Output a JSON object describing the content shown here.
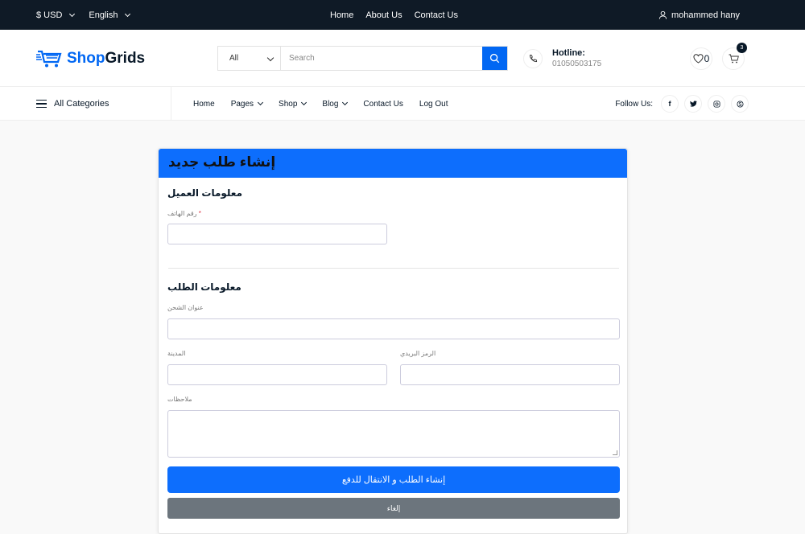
{
  "topbar": {
    "currency": "$ USD",
    "language": "English",
    "links": [
      "Home",
      "About Us",
      "Contact Us"
    ],
    "user": "mohammed hany"
  },
  "header": {
    "logo_part1": "Shop",
    "logo_part2": "Grids",
    "search_category": "All",
    "search_placeholder": "Search",
    "hotline_label": "Hotline:",
    "hotline_number": "01050503175",
    "wishlist_count": "0",
    "cart_count": "3"
  },
  "nav": {
    "all_categories": "All Categories",
    "items": [
      "Home",
      "Pages",
      "Shop",
      "Blog",
      "Contact Us",
      "Log Out"
    ],
    "follow_us": "Follow Us:"
  },
  "form": {
    "title": "إنشاء طلب جديد",
    "customer_section": "معلومات العميل",
    "phone_label": "رقم الهاتف",
    "required_mark": "*",
    "order_section": "معلومات الطلب",
    "address_label": "عنوان الشحن",
    "city_label": "المدينة",
    "zip_label": "الرمز البريدي",
    "notes_label": "ملاحظات",
    "submit_label": "إنشاء الطلب و الانتقال للدفع",
    "cancel_label": "إلغاء"
  },
  "colors": {
    "accent": "#0167f3",
    "primary_button": "#0d6efd",
    "secondary_button": "#6c757d",
    "topbar_bg": "#0f1a26"
  }
}
